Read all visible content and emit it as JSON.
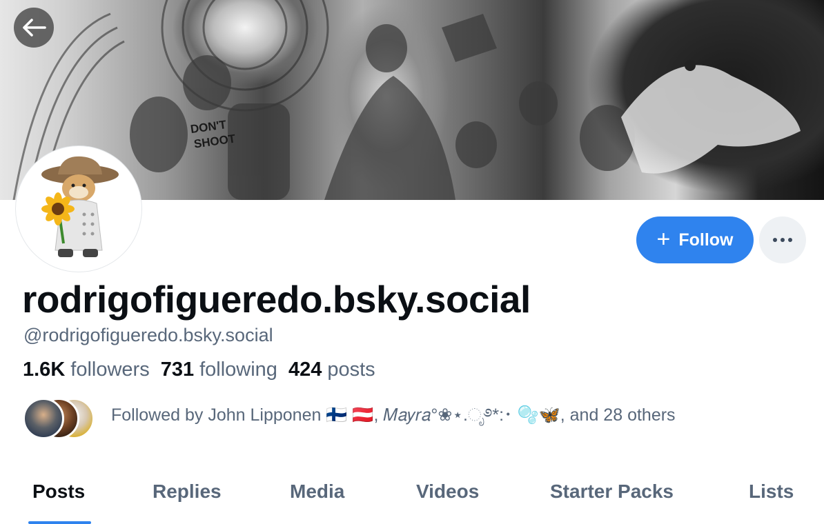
{
  "profile": {
    "display_name": "rodrigofigueredo.bsky.social",
    "handle": "@rodrigofigueredo.bsky.social"
  },
  "actions": {
    "follow_label": "Follow",
    "more_label": "•••"
  },
  "stats": {
    "followers_count": "1.6K",
    "followers_label": "followers",
    "following_count": "731",
    "following_label": "following",
    "posts_count": "424",
    "posts_label": "posts"
  },
  "followed_by": {
    "text": "Followed by John Lipponen 🇫🇮 🇦🇹, 𝑀𝑎𝑦𝑟𝑎°❀⋆.ೃ࿔*:･ 🫧🦋, and 28 others"
  },
  "tabs": [
    {
      "label": "Posts",
      "active": true
    },
    {
      "label": "Replies"
    },
    {
      "label": "Media"
    },
    {
      "label": "Videos"
    },
    {
      "label": "Starter Packs"
    },
    {
      "label": "Lists"
    }
  ],
  "colors": {
    "accent": "#2f83ee",
    "text_primary": "#0b0f14",
    "text_secondary": "#58677a",
    "more_button_bg": "#eef1f4"
  },
  "icons": {
    "back": "arrow-left-icon",
    "follow": "plus-icon",
    "more": "ellipsis-icon"
  }
}
